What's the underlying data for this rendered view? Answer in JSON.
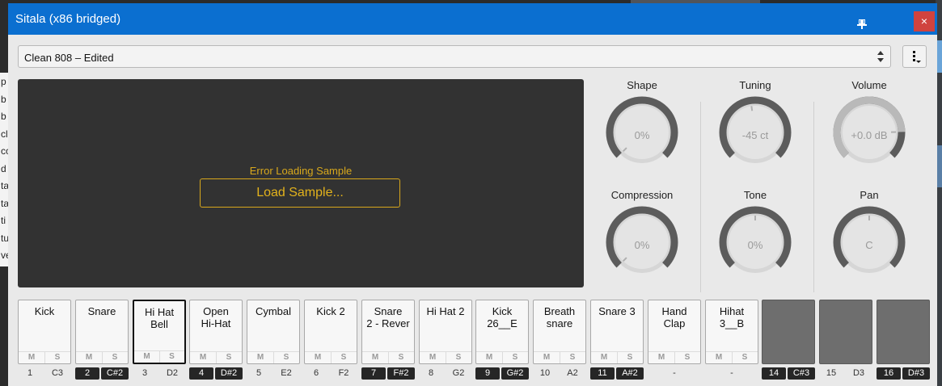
{
  "window": {
    "title": "Sitala (x86 bridged)",
    "close_label": "×"
  },
  "preset": {
    "name": "Clean 808 – Edited"
  },
  "sample": {
    "error": "Error Loading Sample",
    "load_button": "Load Sample..."
  },
  "knobs": [
    {
      "label": "Shape",
      "value": "0%",
      "level": 0.0
    },
    {
      "label": "Tuning",
      "value": "-45 ct",
      "level": 0.47
    },
    {
      "label": "Volume",
      "value": "+0.0 dB",
      "level": 0.83
    },
    {
      "label": "Compression",
      "value": "0%",
      "level": 0.0
    },
    {
      "label": "Tone",
      "value": "0%",
      "level": 0.5
    },
    {
      "label": "Pan",
      "value": "C",
      "level": 0.5
    }
  ],
  "pads": [
    {
      "name": "Kick",
      "num": "1",
      "note": "C3",
      "hl": false
    },
    {
      "name": "Snare",
      "num": "2",
      "note": "C#2",
      "hl": true
    },
    {
      "name": "Hi Hat\nBell",
      "num": "3",
      "note": "D2",
      "hl": false,
      "selected": true
    },
    {
      "name": "Open\nHi-Hat",
      "num": "4",
      "note": "D#2",
      "hl": true
    },
    {
      "name": "Cymbal",
      "num": "5",
      "note": "E2",
      "hl": false
    },
    {
      "name": "Kick 2",
      "num": "6",
      "note": "F2",
      "hl": false
    },
    {
      "name": "Snare\n2 - Rever",
      "num": "7",
      "note": "F#2",
      "hl": true
    },
    {
      "name": "Hi Hat 2",
      "num": "8",
      "note": "G2",
      "hl": false
    },
    {
      "name": "Kick\n26__E",
      "num": "9",
      "note": "G#2",
      "hl": true
    },
    {
      "name": "Breath\nsnare",
      "num": "10",
      "note": "A2",
      "hl": false
    },
    {
      "name": "Snare 3",
      "num": "11",
      "note": "A#2",
      "hl": true
    },
    {
      "name": "Hand\nClap",
      "num": "",
      "note": "",
      "dash": "-"
    },
    {
      "name": "Hihat\n3__B",
      "num": "",
      "note": "",
      "dash": "-"
    },
    {
      "name": "",
      "num": "14",
      "note": "C#3",
      "hl": true,
      "empty": true
    },
    {
      "name": "",
      "num": "15",
      "note": "D3",
      "hl": false,
      "empty": true
    },
    {
      "name": "",
      "num": "16",
      "note": "D#3",
      "hl": true,
      "empty": true
    }
  ],
  "pad_ms": {
    "mute": "M",
    "solo": "S"
  },
  "host_text": [
    "p",
    "b",
    "b",
    "cl",
    "cc",
    "d",
    "ta",
    "ta",
    "ti",
    "tu",
    "ve"
  ],
  "icons": {
    "pin": "pin-icon",
    "close": "close-icon",
    "menu": "kebab-menu-icon",
    "updown": "up-down-arrows-icon"
  },
  "colors": {
    "title_bar": "#0b6fd0",
    "accent": "#d8a81c",
    "knob_ring": "#5c5c5c",
    "knob_body": "#d6d6d6"
  }
}
